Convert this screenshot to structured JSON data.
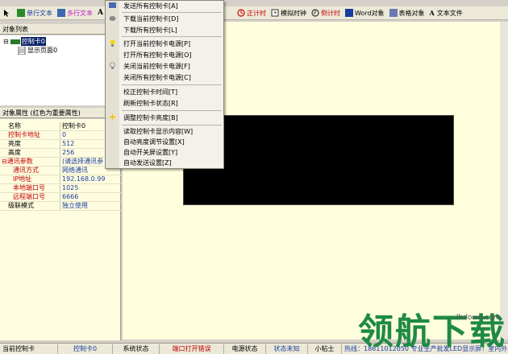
{
  "toolbar": {
    "single_text": "单行文本",
    "multi_text": "多行文本",
    "a_glyph": "A",
    "countup": "正计时",
    "analog_clock": "模拟时钟",
    "countdown": "倒计时",
    "word_object": "Word对象",
    "table_object": "表格对象",
    "text_file": "文本文件"
  },
  "object_list": {
    "title": "对象列表",
    "controller": "控制卡0",
    "page": "显示页面0"
  },
  "properties": {
    "title": "对象属性 (红色为重要属性)",
    "rows": [
      {
        "name": "名称",
        "value": "控制卡0",
        "red": false
      },
      {
        "name": "控制卡地址",
        "value": "0",
        "red": true
      },
      {
        "name": "亮度",
        "value": "512",
        "red": false
      },
      {
        "name": "高度",
        "value": "256",
        "red": false
      },
      {
        "name": "通讯参数",
        "value": "(请选择通讯参",
        "red": true
      },
      {
        "name": "通讯方式",
        "value": "网络通讯",
        "red": true
      },
      {
        "name": "IP地址",
        "value": "192.168.0.99",
        "red": true
      },
      {
        "name": "本地端口号",
        "value": "1025",
        "red": true
      },
      {
        "name": "远程端口号",
        "value": "6666",
        "red": true
      },
      {
        "name": "级联模式",
        "value": "独立使用",
        "red": false
      }
    ]
  },
  "menu": {
    "items": [
      "发送所有控制卡[A]",
      "下载当前控制卡[D]",
      "下载所有控制卡[L]",
      "打开当前控制卡电源[P]",
      "打开所有控制卡电源[O]",
      "关闭当前控制卡电源[F]",
      "关闭所有控制卡电源[C]",
      "校正控制卡时间[T]",
      "刷新控制卡状态[R]",
      "调整控制卡亮度[B]",
      "读取控制卡显示内容[W]",
      "自动亮度调节设置[X]",
      "自动开关屏设置[Y]",
      "自动发送设置[Z]"
    ]
  },
  "status": {
    "current_card_label": "当前控制卡",
    "current_card": "控制卡0",
    "sys_status_label": "系统状态",
    "sys_status": "端口打开错误",
    "power_label": "电源状态",
    "power": "状态未知",
    "helper": "小帖士",
    "tip": "热线：18611012050 专业生产批发LED显示屏！室内外单"
  },
  "watermark": {
    "text": "领航下载",
    "url": "lhdown.com"
  },
  "colors": {
    "canvas": "#ffffdd",
    "selection": "#0a246a",
    "important": "#c00000",
    "watermark": "#1f8a45"
  }
}
